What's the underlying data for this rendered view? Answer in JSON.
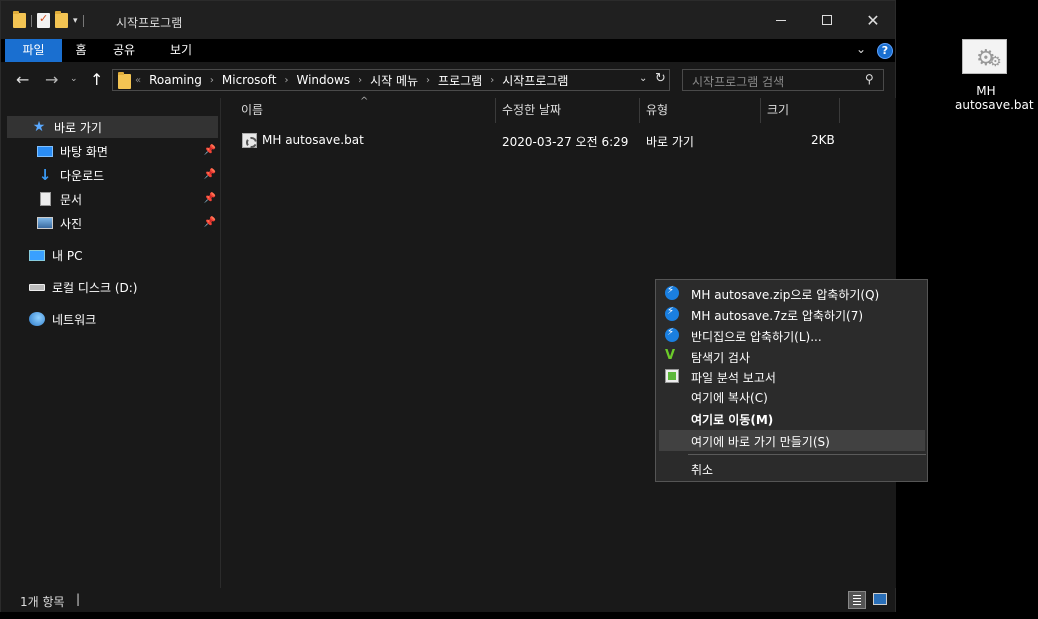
{
  "window": {
    "title": "시작프로그램"
  },
  "ribbon": {
    "tabs": [
      "파일",
      "홈",
      "공유",
      "보기"
    ],
    "help_glyph": "?"
  },
  "navbar": {
    "breadcrumbs": [
      "Roaming",
      "Microsoft",
      "Windows",
      "시작 메뉴",
      "프로그램",
      "시작프로그램"
    ],
    "search_placeholder": "시작프로그램 검색"
  },
  "sidebar": {
    "items": [
      {
        "label": "바로 가기",
        "icon": "star-icon",
        "pinned": false,
        "selected": true
      },
      {
        "label": "바탕 화면",
        "icon": "desktop-icon",
        "pinned": true
      },
      {
        "label": "다운로드",
        "icon": "download-icon",
        "pinned": true
      },
      {
        "label": "문서",
        "icon": "document-icon",
        "pinned": true
      },
      {
        "label": "사진",
        "icon": "pictures-icon",
        "pinned": true
      },
      {
        "label": "내 PC",
        "icon": "pc-icon",
        "pinned": false
      },
      {
        "label": "로컬 디스크 (D:)",
        "icon": "drive-icon",
        "pinned": false
      },
      {
        "label": "네트워크",
        "icon": "network-icon",
        "pinned": false
      }
    ]
  },
  "columns": {
    "name": "이름",
    "date": "수정한 날짜",
    "type": "유형",
    "size": "크기"
  },
  "files": [
    {
      "name": "MH autosave.bat",
      "date": "2020-03-27 오전 6:29",
      "type": "바로 가기",
      "size": "2KB"
    }
  ],
  "status": {
    "item_count": "1개 항목",
    "caret": "|"
  },
  "context_menu": {
    "items": [
      {
        "label": "MH autosave.zip으로 압축하기(Q)",
        "icon": "bandizip-icon"
      },
      {
        "label": "MH autosave.7z로 압축하기(7)",
        "icon": "bandizip-icon"
      },
      {
        "label": "반디집으로 압축하기(L)...",
        "icon": "bandizip-icon"
      },
      {
        "label": "탐색기 검사",
        "icon": "v3-icon"
      },
      {
        "label": "파일 분석 보고서",
        "icon": "report-icon"
      },
      {
        "label": "여기에 복사(C)",
        "icon": ""
      },
      {
        "label": "여기로 이동(M)",
        "icon": "",
        "bold": true
      },
      {
        "label": "여기에 바로 가기 만들기(S)",
        "icon": "",
        "hover": true
      },
      {
        "label": "취소",
        "icon": ""
      }
    ]
  },
  "desktop_icon": {
    "label_line1": "MH",
    "label_line2": "autosave.bat"
  },
  "colors": {
    "accent": "#1a6fd0",
    "window_bg": "#191919",
    "menu_bg": "#2b2b2b"
  }
}
